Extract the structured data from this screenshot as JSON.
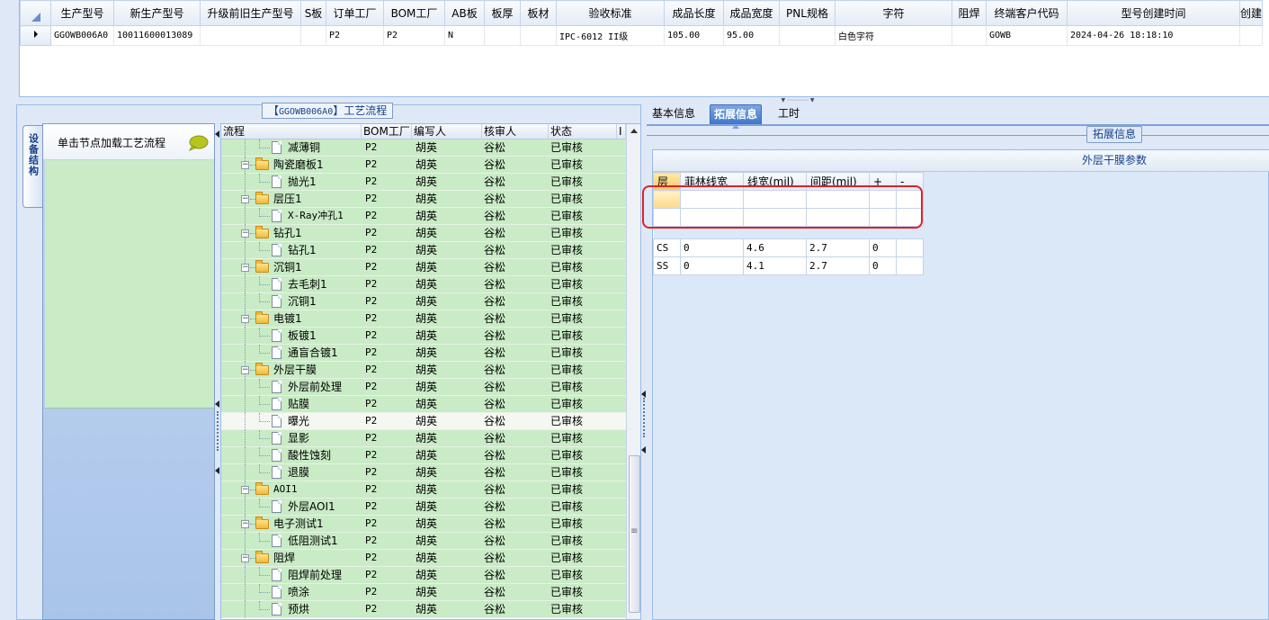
{
  "top_grid": {
    "columns": [
      "生产型号",
      "新生产型号",
      "升级前旧生产型号",
      "S板",
      "订单工厂",
      "BOM工厂",
      "AB板",
      "板厚",
      "板材",
      "验收标准",
      "成品长度",
      "成品宽度",
      "PNL规格",
      "字符",
      "阻焊",
      "终端客户代码",
      "型号创建时间",
      "创建"
    ],
    "row": [
      "GGOWB006A0",
      "10011600013089",
      "",
      "",
      "P2",
      "P2",
      "N",
      "",
      "",
      "IPC-6012 II级",
      "105.00",
      "95.00",
      "",
      "白色字符",
      "",
      "GOWB",
      "2024-04-26 18:18:10",
      ""
    ]
  },
  "left": {
    "flow_title_pre": "【",
    "flow_code": "GGOWB006A0",
    "flow_title_post": "】工艺流程",
    "vertical_tab": "设备结构",
    "node_hint": "单击节点加载工艺流程"
  },
  "tree": {
    "columns": [
      "流程",
      "BOM工厂",
      "编写人",
      "核审人",
      "状态",
      "I"
    ],
    "rows": [
      {
        "name": "减薄铜",
        "level": 1,
        "folder": false,
        "bom": "P2",
        "writer": "胡英",
        "reviewer": "谷松",
        "status": "已审核"
      },
      {
        "name": "陶瓷磨板1",
        "level": 0,
        "folder": true,
        "bom": "P2",
        "writer": "胡英",
        "reviewer": "谷松",
        "status": "已审核"
      },
      {
        "name": "抛光1",
        "level": 1,
        "folder": false,
        "bom": "P2",
        "writer": "胡英",
        "reviewer": "谷松",
        "status": "已审核"
      },
      {
        "name": "层压1",
        "level": 0,
        "folder": true,
        "bom": "P2",
        "writer": "胡英",
        "reviewer": "谷松",
        "status": "已审核"
      },
      {
        "name": "X-Ray冲孔1",
        "level": 1,
        "folder": false,
        "bom": "P2",
        "writer": "胡英",
        "reviewer": "谷松",
        "status": "已审核"
      },
      {
        "name": "钻孔1",
        "level": 0,
        "folder": true,
        "bom": "P2",
        "writer": "胡英",
        "reviewer": "谷松",
        "status": "已审核"
      },
      {
        "name": "钻孔1",
        "level": 1,
        "folder": false,
        "bom": "P2",
        "writer": "胡英",
        "reviewer": "谷松",
        "status": "已审核"
      },
      {
        "name": "沉铜1",
        "level": 0,
        "folder": true,
        "bom": "P2",
        "writer": "胡英",
        "reviewer": "谷松",
        "status": "已审核"
      },
      {
        "name": "去毛刺1",
        "level": 1,
        "folder": false,
        "bom": "P2",
        "writer": "胡英",
        "reviewer": "谷松",
        "status": "已审核"
      },
      {
        "name": "沉铜1",
        "level": 1,
        "folder": false,
        "bom": "P2",
        "writer": "胡英",
        "reviewer": "谷松",
        "status": "已审核"
      },
      {
        "name": "电镀1",
        "level": 0,
        "folder": true,
        "bom": "P2",
        "writer": "胡英",
        "reviewer": "谷松",
        "status": "已审核"
      },
      {
        "name": "板镀1",
        "level": 1,
        "folder": false,
        "bom": "P2",
        "writer": "胡英",
        "reviewer": "谷松",
        "status": "已审核"
      },
      {
        "name": "通盲合镀1",
        "level": 1,
        "folder": false,
        "bom": "P2",
        "writer": "胡英",
        "reviewer": "谷松",
        "status": "已审核"
      },
      {
        "name": "外层干膜",
        "level": 0,
        "folder": true,
        "bom": "P2",
        "writer": "胡英",
        "reviewer": "谷松",
        "status": "已审核"
      },
      {
        "name": "外层前处理",
        "level": 1,
        "folder": false,
        "bom": "P2",
        "writer": "胡英",
        "reviewer": "谷松",
        "status": "已审核"
      },
      {
        "name": "贴膜",
        "level": 1,
        "folder": false,
        "bom": "P2",
        "writer": "胡英",
        "reviewer": "谷松",
        "status": "已审核"
      },
      {
        "name": "曝光",
        "level": 1,
        "folder": false,
        "bom": "P2",
        "writer": "胡英",
        "reviewer": "谷松",
        "status": "已审核",
        "selected": true
      },
      {
        "name": "显影",
        "level": 1,
        "folder": false,
        "bom": "P2",
        "writer": "胡英",
        "reviewer": "谷松",
        "status": "已审核"
      },
      {
        "name": "酸性蚀刻",
        "level": 1,
        "folder": false,
        "bom": "P2",
        "writer": "胡英",
        "reviewer": "谷松",
        "status": "已审核"
      },
      {
        "name": "退膜",
        "level": 1,
        "folder": false,
        "bom": "P2",
        "writer": "胡英",
        "reviewer": "谷松",
        "status": "已审核"
      },
      {
        "name": "AOI1",
        "level": 0,
        "folder": true,
        "bom": "P2",
        "writer": "胡英",
        "reviewer": "谷松",
        "status": "已审核"
      },
      {
        "name": "外层AOI1",
        "level": 1,
        "folder": false,
        "bom": "P2",
        "writer": "胡英",
        "reviewer": "谷松",
        "status": "已审核"
      },
      {
        "name": "电子测试1",
        "level": 0,
        "folder": true,
        "bom": "P2",
        "writer": "胡英",
        "reviewer": "谷松",
        "status": "已审核"
      },
      {
        "name": "低阻测试1",
        "level": 1,
        "folder": false,
        "bom": "P2",
        "writer": "胡英",
        "reviewer": "谷松",
        "status": "已审核"
      },
      {
        "name": "阻焊",
        "level": 0,
        "folder": true,
        "bom": "P2",
        "writer": "胡英",
        "reviewer": "谷松",
        "status": "已审核"
      },
      {
        "name": "阻焊前处理",
        "level": 1,
        "folder": false,
        "bom": "P2",
        "writer": "胡英",
        "reviewer": "谷松",
        "status": "已审核"
      },
      {
        "name": "喷涂",
        "level": 1,
        "folder": false,
        "bom": "P2",
        "writer": "胡英",
        "reviewer": "谷松",
        "status": "已审核"
      },
      {
        "name": "预烘",
        "level": 1,
        "folder": false,
        "bom": "P2",
        "writer": "胡英",
        "reviewer": "谷松",
        "status": "已审核"
      }
    ]
  },
  "right": {
    "tabs": [
      {
        "label": "基本信息",
        "active": false
      },
      {
        "label": "拓展信息",
        "active": true
      },
      {
        "label": "工时",
        "active": false
      }
    ],
    "legend": "拓展信息",
    "dry_film": {
      "caption": "外层干膜参数",
      "columns": [
        "层",
        "菲林线宽",
        "线宽(mil)",
        "间距(mil)",
        "+",
        "-"
      ],
      "blank_rows": 2,
      "rows": [
        [
          "CS",
          "0",
          "4.6",
          "2.7",
          "0",
          ""
        ],
        [
          "SS",
          "0",
          "4.1",
          "2.7",
          "0",
          ""
        ]
      ]
    }
  },
  "colors": {
    "accent": "#3f76c8",
    "tree_row": "#c9ebc6",
    "highlight": "#e0202a"
  }
}
